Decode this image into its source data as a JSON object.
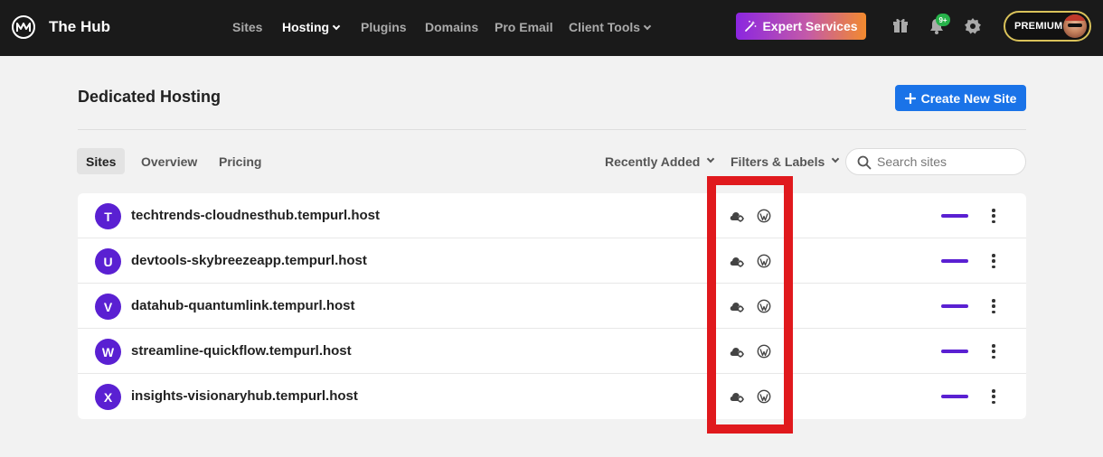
{
  "app": {
    "name": "The Hub"
  },
  "nav": {
    "items": [
      {
        "label": "Sites",
        "active": false,
        "has_dropdown": false
      },
      {
        "label": "Hosting",
        "active": true,
        "has_dropdown": true
      },
      {
        "label": "Plugins",
        "active": false,
        "has_dropdown": false
      },
      {
        "label": "Domains",
        "active": false,
        "has_dropdown": false
      },
      {
        "label": "Pro Email",
        "active": false,
        "has_dropdown": false
      },
      {
        "label": "Client Tools",
        "active": false,
        "has_dropdown": true
      }
    ],
    "expert_services_label": "Expert Services",
    "notification_badge": "9+",
    "account_label": "PREMIUM"
  },
  "page": {
    "title": "Dedicated Hosting",
    "create_button_label": "Create New Site"
  },
  "tabs": [
    {
      "label": "Sites",
      "active": true
    },
    {
      "label": "Overview",
      "active": false
    },
    {
      "label": "Pricing",
      "active": false
    }
  ],
  "filters": {
    "sort_label": "Recently Added",
    "filters_label": "Filters & Labels",
    "search_placeholder": "Search sites"
  },
  "sites": [
    {
      "initial": "T",
      "name": "techtrends-cloudnesthub.tempurl.host"
    },
    {
      "initial": "U",
      "name": "devtools-skybreezeapp.tempurl.host"
    },
    {
      "initial": "V",
      "name": "datahub-quantumlink.tempurl.host"
    },
    {
      "initial": "W",
      "name": "streamline-quickflow.tempurl.host"
    },
    {
      "initial": "X",
      "name": "insights-visionaryhub.tempurl.host"
    }
  ],
  "colors": {
    "accent": "#1a73e8",
    "site_avatar": "#5a20d2",
    "highlight": "#e0191d",
    "topbar": "#1a1a1a"
  },
  "icons": {
    "row_icons": [
      "cloud-gear-icon",
      "wordpress-icon"
    ],
    "top_icons": [
      "gift-icon",
      "bell-icon",
      "gear-icon"
    ]
  }
}
